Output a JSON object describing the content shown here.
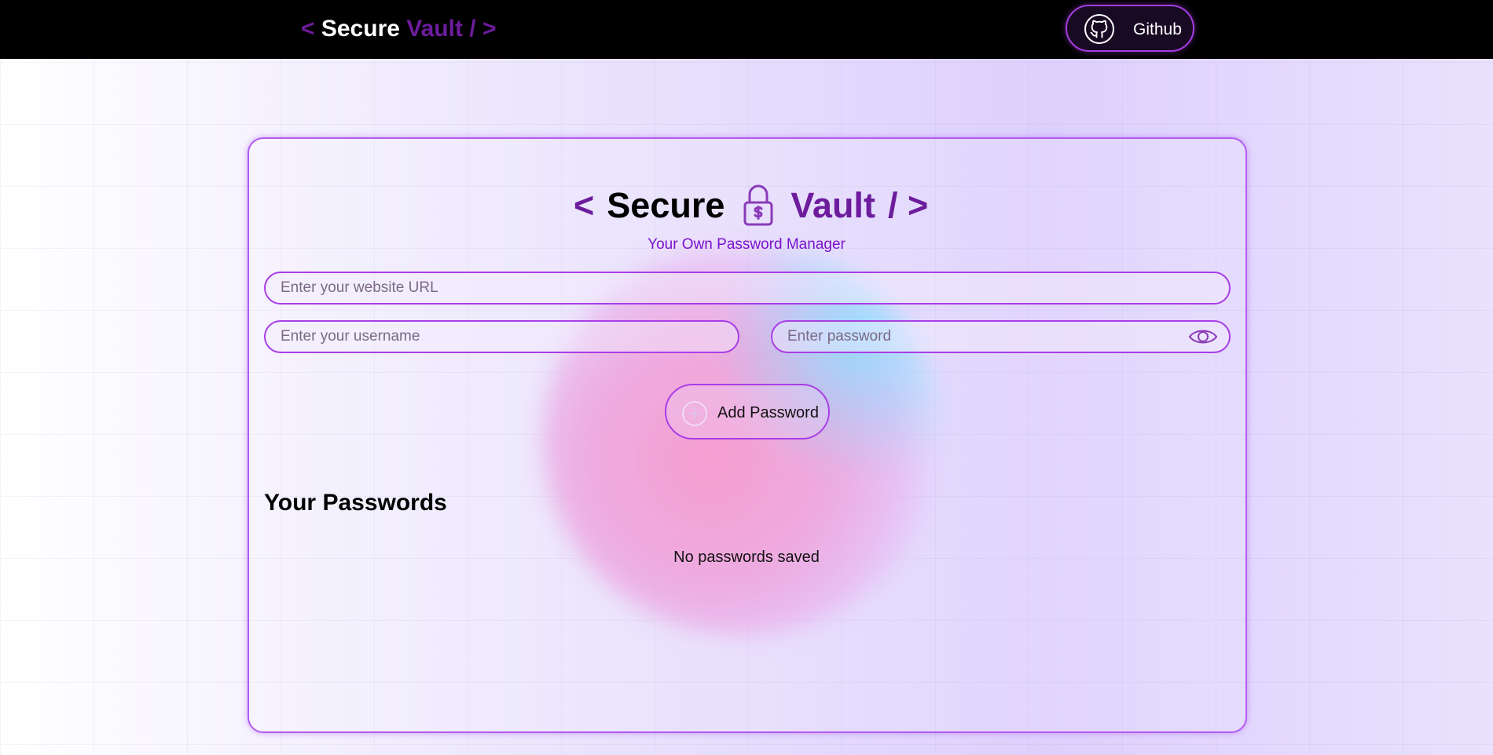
{
  "navbar": {
    "logo": {
      "open": "< ",
      "secure": "Secure",
      "vault": " Vault",
      "close": " / >"
    },
    "github_button": {
      "label": "Github",
      "icon": "github-icon"
    }
  },
  "hero": {
    "title": {
      "open": "<",
      "secure": "Secure",
      "vault": "Vault",
      "close": "/ >"
    },
    "icon": "lock-dollar-icon",
    "subtitle": "Your Own Password Manager"
  },
  "form": {
    "url_placeholder": "Enter your website URL",
    "username_placeholder": "Enter your username",
    "password_placeholder": "Enter password",
    "password_toggle_icon": "eye-icon",
    "add_button": {
      "label": "Add Password",
      "icon": "add-icon"
    }
  },
  "passwords": {
    "heading": "Your Passwords",
    "empty_message": "No passwords saved"
  },
  "colors": {
    "brand_purple": "#6d1c9c",
    "accent_border": "#a93ee6",
    "navbar_bg": "#000000"
  }
}
